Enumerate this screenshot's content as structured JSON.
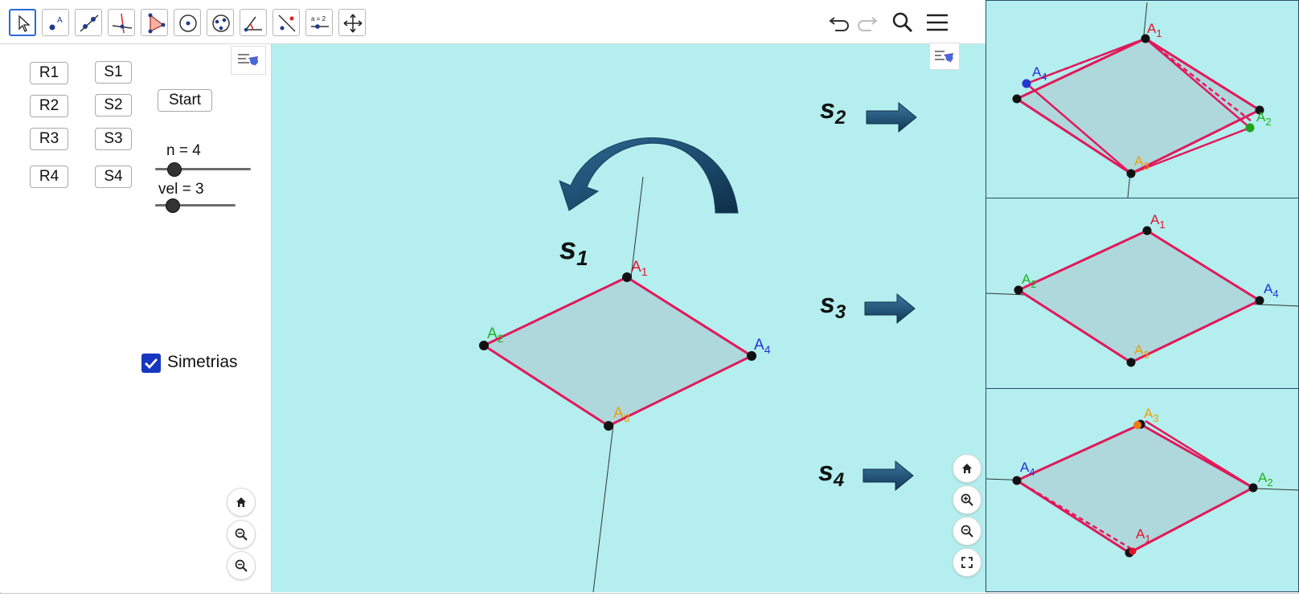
{
  "toolbar": {
    "tools": [
      "move-tool",
      "point-tool",
      "line-tool",
      "perpendicular-line-tool",
      "polygon-tool",
      "circle-tool",
      "conic-tool",
      "angle-tool",
      "reflect-tool",
      "slider-tool",
      "move-graphics-tool"
    ],
    "slider_tool_label": "a = 2",
    "actions": [
      "undo-icon",
      "redo-icon",
      "search-icon",
      "menu-icon"
    ]
  },
  "algebra": {
    "buttons": {
      "r1": "R1",
      "r2": "R2",
      "r3": "R3",
      "r4": "R4",
      "s1": "S1",
      "s2": "S2",
      "s3": "S3",
      "s4": "S4",
      "start": "Start"
    },
    "sliders": {
      "n": {
        "label": "n = 4",
        "value": 4,
        "level": 0.15
      },
      "vel": {
        "label": "vel = 3",
        "value": 3,
        "level": 0.2
      }
    },
    "checkbox": {
      "label": "Simetrias",
      "checked": true
    }
  },
  "graphics": {
    "main_symmetry_label": "s",
    "main_symmetry_sub": "1",
    "vertex_labels": {
      "a1": {
        "base": "A",
        "sub": "1",
        "color": "#e3122a"
      },
      "a2": {
        "base": "A",
        "sub": "2",
        "color": "#1db31d"
      },
      "a3": {
        "base": "A",
        "sub": "3",
        "color": "#f0a000"
      },
      "a4": {
        "base": "A",
        "sub": "4",
        "color": "#1f33d9"
      }
    },
    "arrows": [
      {
        "label": "s",
        "sub": "2"
      },
      {
        "label": "s",
        "sub": "3"
      },
      {
        "label": "s",
        "sub": "4"
      }
    ],
    "colors": {
      "background": "#b4eeee",
      "polygon_fill": "#aed8dc",
      "edge": "#e0195a",
      "arrow": "#1d4f73"
    }
  },
  "thumbnails": [
    {
      "a1": "A",
      "s1": "1",
      "a2": "A",
      "s2": "2",
      "a3": "A",
      "s3": "3",
      "a4": "A",
      "s4": "4"
    },
    {
      "a1": "A",
      "s1": "1",
      "a2": "A",
      "s2": "2",
      "a3": "A",
      "s3": "3",
      "a4": "A",
      "s4": "4"
    },
    {
      "a1": "A",
      "s1": "1",
      "a2": "A",
      "s2": "2",
      "a3": "A",
      "s3": "3",
      "a4": "A",
      "s4": "4"
    }
  ],
  "view_controls": [
    "home-icon",
    "zoom-in-icon",
    "zoom-out-icon",
    "fullscreen-icon"
  ]
}
